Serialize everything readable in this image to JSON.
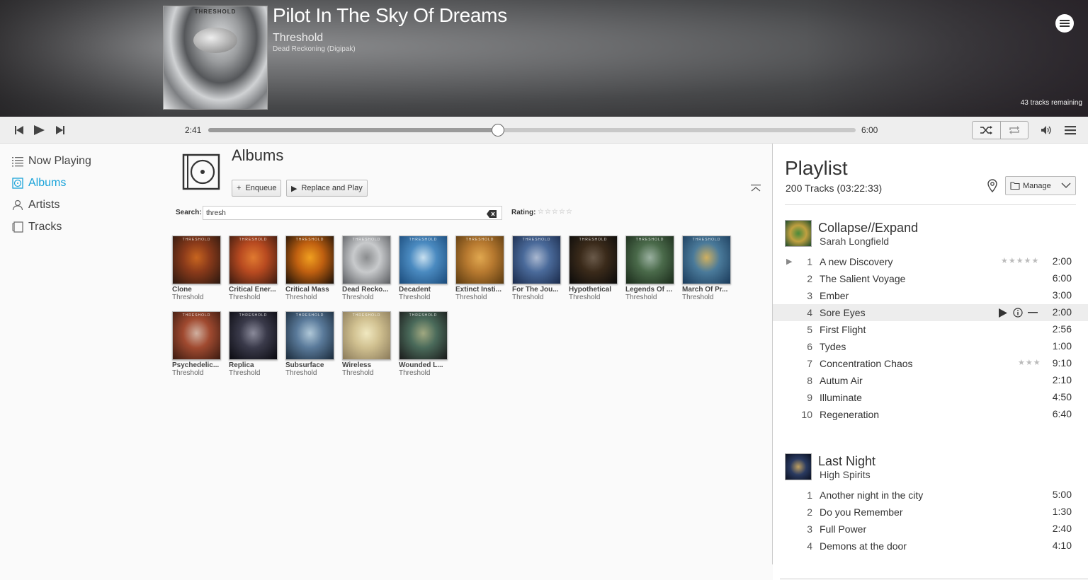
{
  "now_playing": {
    "title": "Pilot In The Sky Of Dreams",
    "artist": "Threshold",
    "album": "Dead Reckoning (Digipak)",
    "cover_logo": "THRESHOLD",
    "remaining": "43 tracks remaining"
  },
  "player": {
    "current_time": "2:41",
    "total_time": "6:00",
    "progress_fraction": 0.447
  },
  "sidebar": {
    "items": [
      {
        "label": "Now Playing",
        "icon": "list-icon",
        "active": false
      },
      {
        "label": "Albums",
        "icon": "album-icon",
        "active": true
      },
      {
        "label": "Artists",
        "icon": "artist-icon",
        "active": false
      },
      {
        "label": "Tracks",
        "icon": "tracks-icon",
        "active": false
      }
    ]
  },
  "albums_view": {
    "title": "Albums",
    "enqueue_label": "Enqueue",
    "replace_play_label": "Replace and Play",
    "search_label": "Search:",
    "search_value": "thresh",
    "rating_label": "Rating:",
    "rating_stars": "☆☆☆☆☆",
    "albums": [
      {
        "name": "Clone",
        "artist": "Threshold",
        "colors": [
          "#2a1810",
          "#8a3a1a",
          "#c8651f"
        ]
      },
      {
        "name": "Critical Ener...",
        "artist": "Threshold",
        "colors": [
          "#3a1a10",
          "#b84a20",
          "#e07a30"
        ]
      },
      {
        "name": "Critical Mass",
        "artist": "Threshold",
        "colors": [
          "#1a1008",
          "#c06010",
          "#f0a020"
        ]
      },
      {
        "name": "Dead Recko...",
        "artist": "Threshold",
        "colors": [
          "#5a5c60",
          "#c8cacc",
          "#8a8c8e"
        ]
      },
      {
        "name": "Decadent",
        "artist": "Threshold",
        "colors": [
          "#1a4a7a",
          "#4a8ac0",
          "#c8e0f0"
        ]
      },
      {
        "name": "Extinct Insti...",
        "artist": "Threshold",
        "colors": [
          "#5a3a10",
          "#b87a30",
          "#e0a850"
        ]
      },
      {
        "name": "For The Jou...",
        "artist": "Threshold",
        "colors": [
          "#1a2a4a",
          "#4a6a9a",
          "#aab8d0"
        ]
      },
      {
        "name": "Hypothetical",
        "artist": "Threshold",
        "colors": [
          "#0a0a0a",
          "#3a2a1a",
          "#6a5a4a"
        ]
      },
      {
        "name": "Legends Of ...",
        "artist": "Threshold",
        "colors": [
          "#1a2a1a",
          "#4a6a4a",
          "#9ab0a0"
        ]
      },
      {
        "name": "March Of Pr...",
        "artist": "Threshold",
        "colors": [
          "#1a3a5a",
          "#4a7a9a",
          "#d0b060"
        ]
      },
      {
        "name": "Psychedelic...",
        "artist": "Threshold",
        "colors": [
          "#3a1a10",
          "#a04a30",
          "#d0b0a0"
        ]
      },
      {
        "name": "Replica",
        "artist": "Threshold",
        "colors": [
          "#0a0a10",
          "#3a3a4a",
          "#8a8a9a"
        ]
      },
      {
        "name": "Subsurface",
        "artist": "Threshold",
        "colors": [
          "#1a2a3a",
          "#5a7a9a",
          "#b0c8d8"
        ]
      },
      {
        "name": "Wireless",
        "artist": "Threshold",
        "colors": [
          "#8a7a5a",
          "#d0c090",
          "#f0e8c0"
        ]
      },
      {
        "name": "Wounded L...",
        "artist": "Threshold",
        "colors": [
          "#1a1a1a",
          "#4a6a5a",
          "#a0a880"
        ]
      }
    ]
  },
  "playlist": {
    "title": "Playlist",
    "summary": "200 Tracks (03:22:33)",
    "manage_label": "Manage",
    "groups": [
      {
        "title": "Collapse//Expand",
        "artist": "Sarah Longfield",
        "art_colors": [
          "#1a4a2a",
          "#c0a040",
          "#4a8a3a"
        ],
        "tracks": [
          {
            "num": "1",
            "name": "A new Discovery",
            "duration": "2:00",
            "stars": "★★★★★",
            "playing": true
          },
          {
            "num": "2",
            "name": "The Salient Voyage",
            "duration": "6:00"
          },
          {
            "num": "3",
            "name": "Ember",
            "duration": "3:00"
          },
          {
            "num": "4",
            "name": "Sore Eyes",
            "duration": "2:00",
            "hover": true
          },
          {
            "num": "5",
            "name": "First Flight",
            "duration": "2:56"
          },
          {
            "num": "6",
            "name": "Tydes",
            "duration": "1:00"
          },
          {
            "num": "7",
            "name": "Concentration Chaos",
            "duration": "9:10",
            "stars": "★★★"
          },
          {
            "num": "8",
            "name": "Autum Air",
            "duration": "2:10"
          },
          {
            "num": "9",
            "name": "Illuminate",
            "duration": "4:50"
          },
          {
            "num": "10",
            "name": "Regeneration",
            "duration": "6:40"
          }
        ]
      },
      {
        "title": "Last Night",
        "artist": "High Spirits",
        "art_colors": [
          "#0a1020",
          "#2a3a60",
          "#c0a060"
        ],
        "tracks": [
          {
            "num": "1",
            "name": "Another night in the city",
            "duration": "5:00"
          },
          {
            "num": "2",
            "name": "Do you Remember",
            "duration": "1:30"
          },
          {
            "num": "3",
            "name": "Full Power",
            "duration": "2:40"
          },
          {
            "num": "4",
            "name": "Demons at the door",
            "duration": "4:10"
          }
        ]
      }
    ]
  },
  "colors": {
    "accent": "#1aa3d9"
  }
}
